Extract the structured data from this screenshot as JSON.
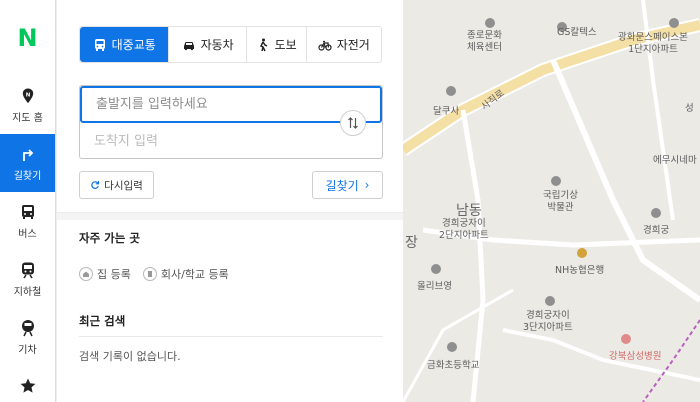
{
  "logo": "N",
  "rail": [
    {
      "label": "지도 홈",
      "icon": "map-pin-icon"
    },
    {
      "label": "길찾기",
      "icon": "directions-icon",
      "active": true
    },
    {
      "label": "버스",
      "icon": "bus-icon"
    },
    {
      "label": "지하철",
      "icon": "subway-icon"
    },
    {
      "label": "기차",
      "icon": "train-icon"
    },
    {
      "label": "",
      "icon": "star-icon"
    }
  ],
  "modes": [
    {
      "label": "대중교통",
      "icon": "bus-icon",
      "active": true
    },
    {
      "label": "자동차",
      "icon": "car-icon"
    },
    {
      "label": "도보",
      "icon": "walk-icon"
    },
    {
      "label": "자전거",
      "icon": "bike-icon"
    }
  ],
  "route": {
    "start_placeholder": "출발지를 입력하세요",
    "end_placeholder": "도착지 입력"
  },
  "actions": {
    "reset_label": "다시입력",
    "find_label": "길찾기"
  },
  "favorites": {
    "title": "자주 가는 곳",
    "home_label": "집 등록",
    "work_label": "회사/학교 등록"
  },
  "recent": {
    "title": "최근 검색",
    "empty": "검색 기록이 없습니다."
  },
  "map_labels": {
    "center": "종로문화\n체육센터",
    "gs": "GS칼텍스",
    "gwanghwamun_apt": "광화문스페이스본\n1단지아파트",
    "dalkusa": "달쿠사",
    "sajikro": "사직로",
    "seong": "성",
    "embassy": "에무시네마",
    "namdong": "남동",
    "gyeonghui_apt2": "경희궁자이\n2단지아파트",
    "meteo": "국립기상\n박물관",
    "gyeonghuigung": "경희궁",
    "jang": "장",
    "nh": "NH농협은행",
    "olive": "올리브영",
    "gyeonghui_apt3": "경희궁자이\n3단지아파트",
    "geumhwa": "금화초등학교",
    "hospital": "강북삼성병원"
  },
  "accent": "#0f74e6",
  "brand": "#03c75a"
}
